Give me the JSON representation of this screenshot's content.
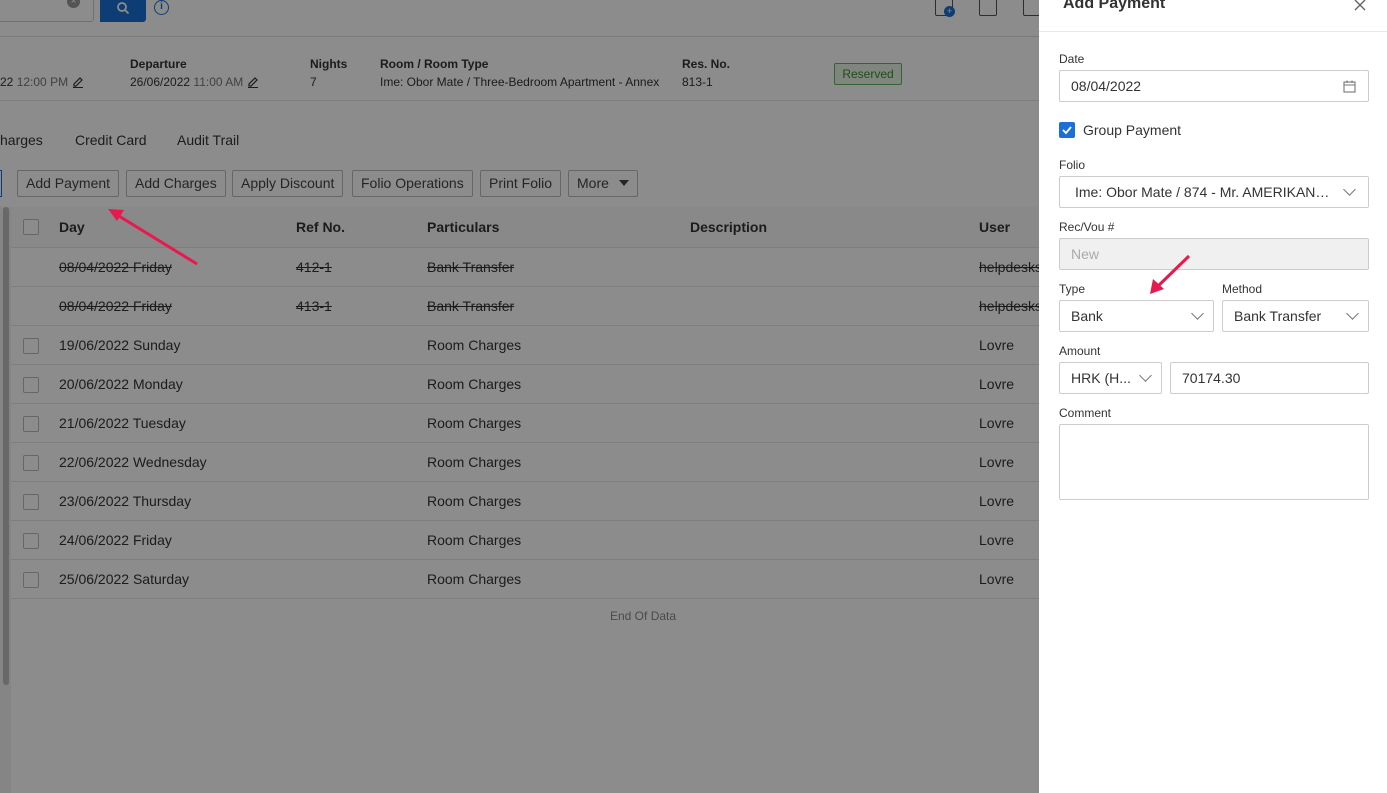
{
  "topbar": {
    "search_clear": "×"
  },
  "reservation": {
    "arrival_value": "22",
    "arrival_time": "12:00 PM",
    "departure_label": "Departure",
    "departure_date": "26/06/2022",
    "departure_time": "11:00 AM",
    "nights_label": "Nights",
    "nights_value": "7",
    "room_label": "Room / Room Type",
    "room_value": "Ime: Obor Mate / Three-Bedroom Apartment - Annex",
    "resno_label": "Res. No.",
    "resno_value": "813-1",
    "status": "Reserved"
  },
  "tabs": [
    "harges",
    "Credit Card",
    "Audit Trail"
  ],
  "toolbar": {
    "add_payment": "Add Payment",
    "add_charges": "Add Charges",
    "apply_discount": "Apply Discount",
    "folio_operations": "Folio Operations",
    "print_folio": "Print Folio",
    "more": "More"
  },
  "table": {
    "headers": {
      "day": "Day",
      "ref": "Ref No.",
      "particulars": "Particulars",
      "description": "Description",
      "user": "User"
    },
    "rows": [
      {
        "day": "08/04/2022 Friday",
        "ref": "412-1",
        "particulars": "Bank Transfer",
        "user": "helpdesks",
        "voided": true
      },
      {
        "day": "08/04/2022 Friday",
        "ref": "413-1",
        "particulars": "Bank Transfer",
        "user": "helpdesks",
        "voided": true
      },
      {
        "day": "19/06/2022 Sunday",
        "ref": "",
        "particulars": "Room Charges",
        "user": "Lovre",
        "voided": false
      },
      {
        "day": "20/06/2022 Monday",
        "ref": "",
        "particulars": "Room Charges",
        "user": "Lovre",
        "voided": false
      },
      {
        "day": "21/06/2022 Tuesday",
        "ref": "",
        "particulars": "Room Charges",
        "user": "Lovre",
        "voided": false
      },
      {
        "day": "22/06/2022 Wednesday",
        "ref": "",
        "particulars": "Room Charges",
        "user": "Lovre",
        "voided": false
      },
      {
        "day": "23/06/2022 Thursday",
        "ref": "",
        "particulars": "Room Charges",
        "user": "Lovre",
        "voided": false
      },
      {
        "day": "24/06/2022 Friday",
        "ref": "",
        "particulars": "Room Charges",
        "user": "Lovre",
        "voided": false
      },
      {
        "day": "25/06/2022 Saturday",
        "ref": "",
        "particulars": "Room Charges",
        "user": "Lovre",
        "voided": false
      }
    ],
    "end_text": "End Of Data"
  },
  "drawer": {
    "title": "Add Payment",
    "date_label": "Date",
    "date_value": "08/04/2022",
    "group_payment_label": "Group Payment",
    "group_payment_checked": true,
    "folio_label": "Folio",
    "folio_value": "Ime: Obor Mate / 874 - Mr. AMERIKANCI...",
    "recvou_label": "Rec/Vou #",
    "recvou_placeholder": "New",
    "type_label": "Type",
    "type_value": "Bank",
    "method_label": "Method",
    "method_value": "Bank Transfer",
    "amount_label": "Amount",
    "currency_value": "HRK (H...",
    "amount_value": "70174.30",
    "comment_label": "Comment"
  },
  "colors": {
    "accent": "#1b6fd6",
    "annotation_arrow": "#e8194f",
    "status_green": "#5cb85c"
  }
}
